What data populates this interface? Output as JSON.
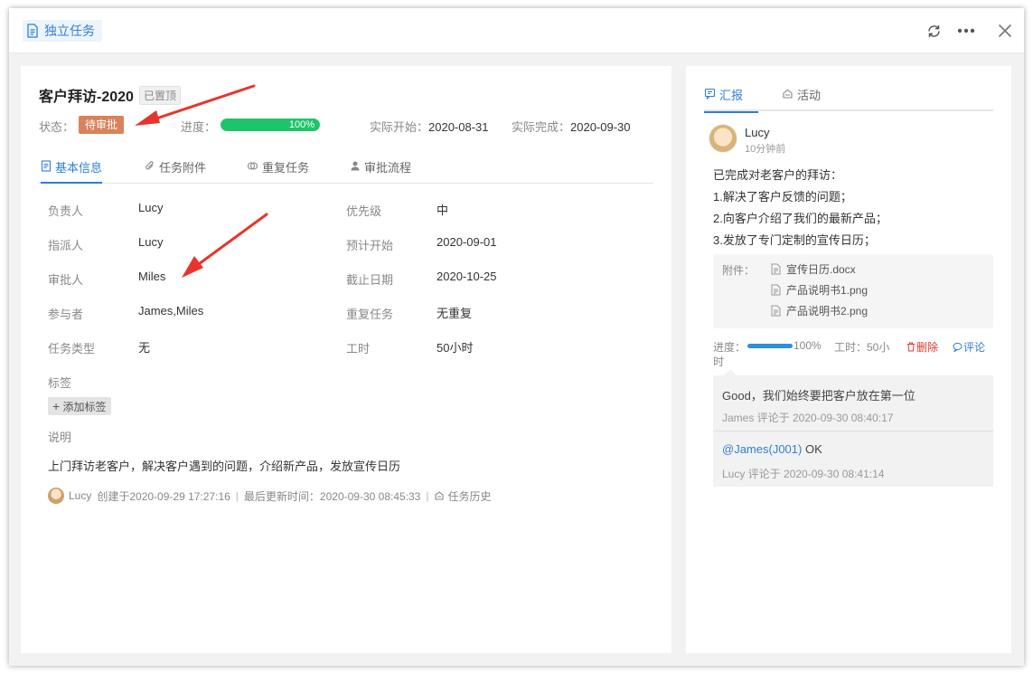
{
  "header": {
    "task_type": "独立任务",
    "icons": [
      "refresh-icon",
      "more-icon",
      "close-icon"
    ]
  },
  "task": {
    "title": "客户拜访-2020",
    "pinned_badge": "已置顶",
    "status_label": "状态：",
    "status_value": "待审批",
    "progress_label": "进度：",
    "progress_value": 1.0,
    "progress_text": "100%",
    "actual_start_label": "实际开始：",
    "actual_start": "2020-08-31",
    "actual_end_label": "实际完成：",
    "actual_end": "2020-09-30"
  },
  "tabs": [
    {
      "label": "基本信息",
      "icon": "document-icon",
      "active": true
    },
    {
      "label": "任务附件",
      "icon": "paperclip-icon",
      "active": false
    },
    {
      "label": "重复任务",
      "icon": "repeat-icon",
      "active": false
    },
    {
      "label": "审批流程",
      "icon": "user-icon",
      "active": false
    }
  ],
  "fields": {
    "owner_label": "负责人",
    "owner": "Lucy",
    "assigner_label": "指派人",
    "assigner": "Lucy",
    "approver_label": "审批人",
    "approver": "Miles",
    "participants_label": "参与者",
    "participants": "James,Miles",
    "type_label": "任务类型",
    "type": "无",
    "priority_label": "优先级",
    "priority": "中",
    "planned_start_label": "预计开始",
    "planned_start": "2020-09-01",
    "deadline_label": "截止日期",
    "deadline": "2020-10-25",
    "repeat_label": "重复任务",
    "repeat": "无重复",
    "hours_label": "工时",
    "hours": "50小时"
  },
  "tags": {
    "label": "标签",
    "add_button": "添加标签"
  },
  "description": {
    "label": "说明",
    "text": "上门拜访老客户，解决客户遇到的问题，介绍新产品，发放宣传日历"
  },
  "meta": {
    "creator": "Lucy",
    "created": "创建于2020-09-29 17:27:16",
    "updated": "最后更新时间：2020-09-30 08:45:33",
    "history_link": "任务历史"
  },
  "right_tabs": [
    {
      "label": "汇报",
      "icon": "report-icon",
      "active": true
    },
    {
      "label": "活动",
      "icon": "activity-icon",
      "active": false
    }
  ],
  "report": {
    "user": "Lucy",
    "time": "10分钟前",
    "lines": [
      "已完成对老客户的拜访：",
      "1.解决了客户反馈的问题；",
      "2.向客户介绍了我们的最新产品；",
      "3.发放了专门定制的宣传日历；"
    ],
    "attachments_label": "附件：",
    "attachments": [
      "宣传日历.docx",
      "产品说明书1.png",
      "产品说明书2.png"
    ],
    "progress_label": "进度：",
    "progress_value": 1.0,
    "progress_text": "100%",
    "hours_text": "工时：50小",
    "hours_wrap": "时",
    "delete_label": "删除",
    "comment_label": "评论"
  },
  "comments": [
    {
      "text": "Good，我们始终要把客户放在第一位",
      "by": "James 评论于 2020-09-30 08:40:17"
    },
    {
      "mention": "@James(J001)",
      "text": " OK",
      "by": "Lucy 评论于 2020-09-30 08:41:14"
    }
  ],
  "colors": {
    "accent": "#2f7fd3",
    "status_tag": "#d9825b",
    "progress": "#1ec46a",
    "annotation_arrow": "#e8352b",
    "delete": "#e8352b"
  }
}
